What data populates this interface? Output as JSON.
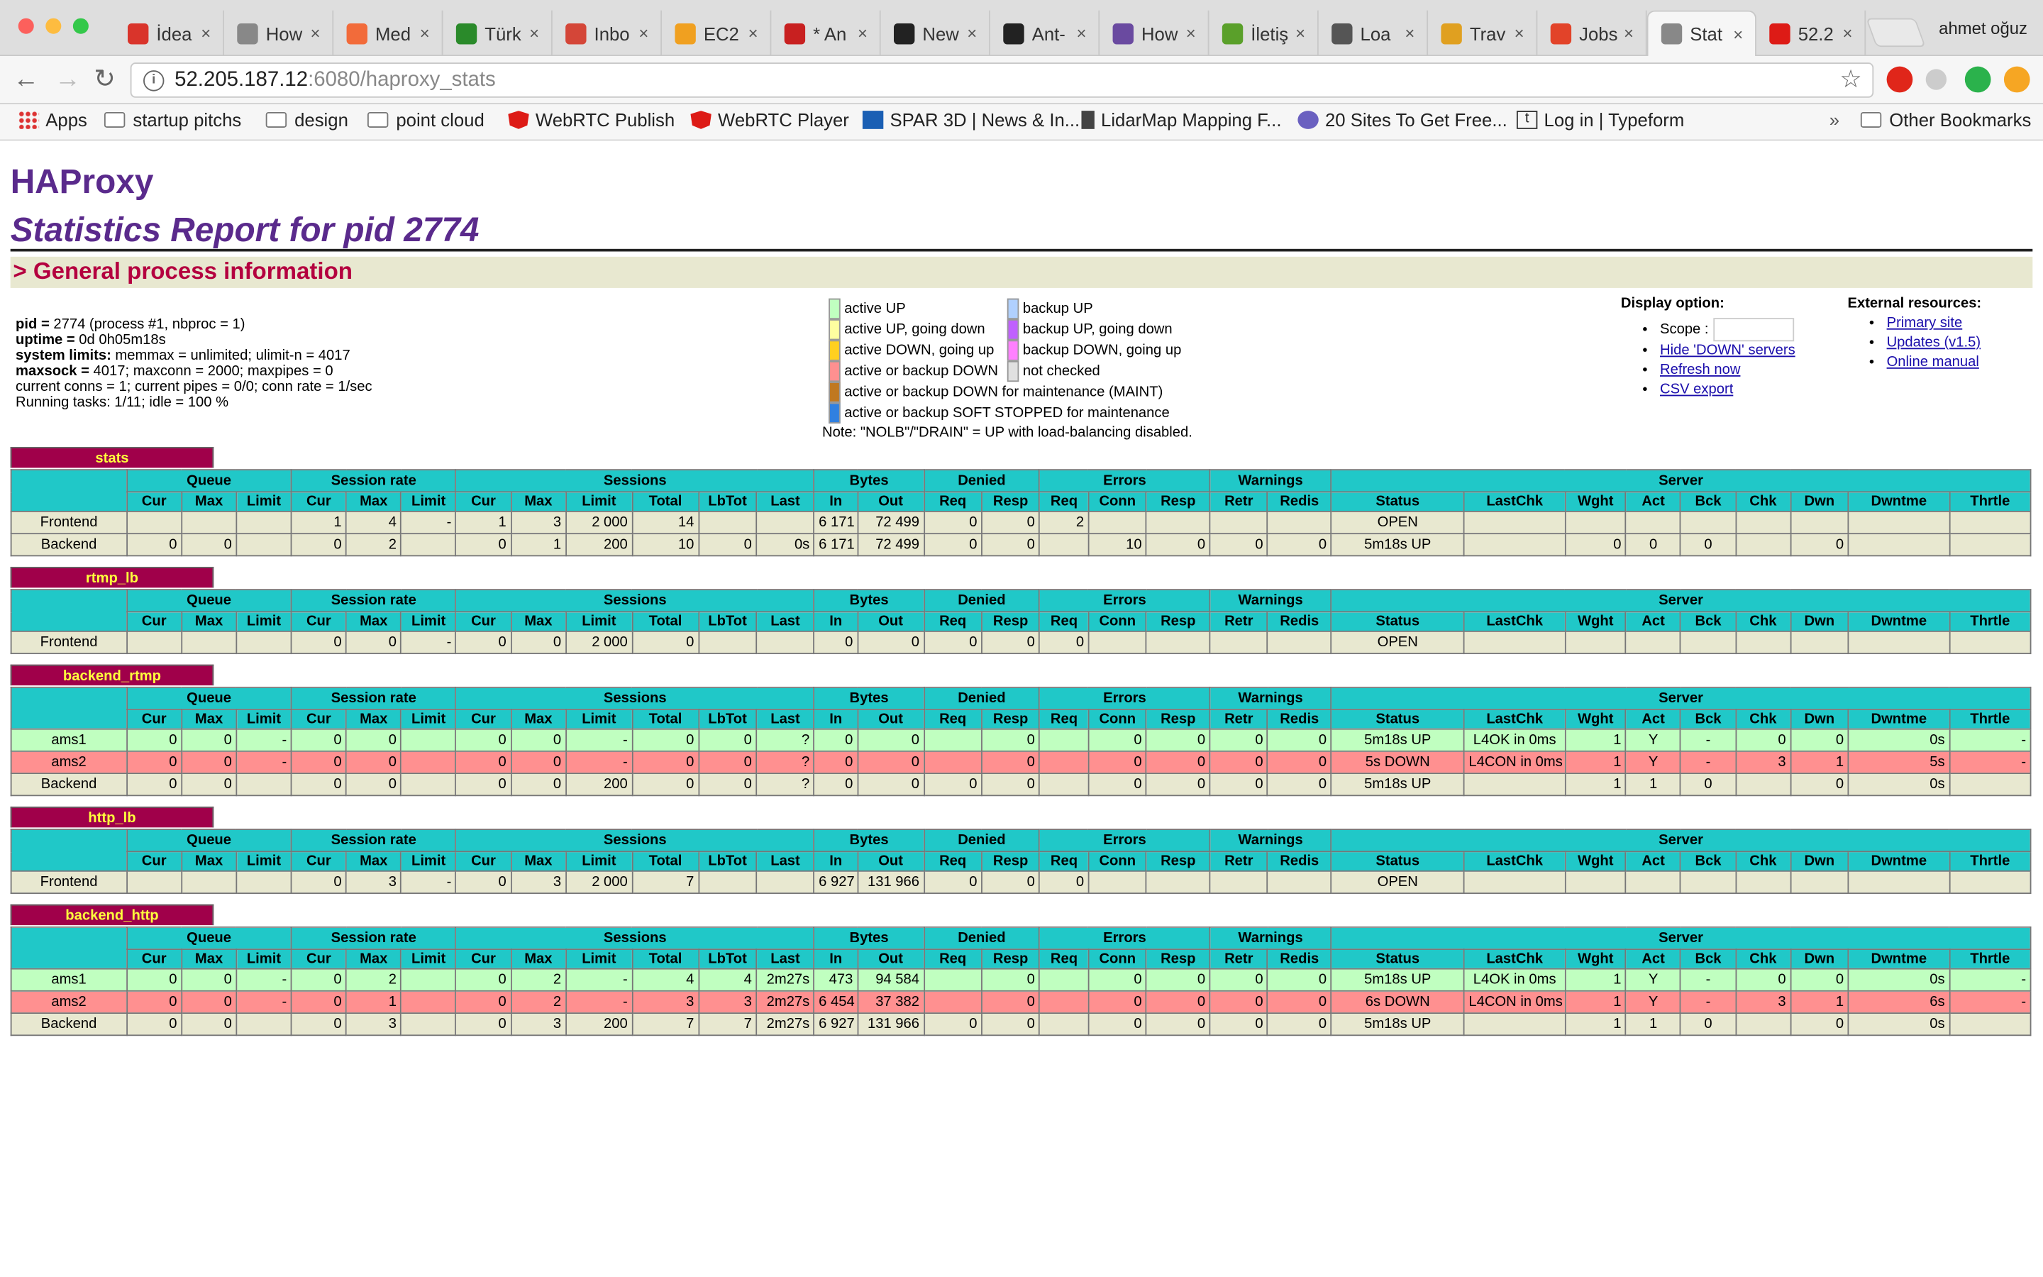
{
  "browser": {
    "profile": "ahmet oğuz",
    "tabs": [
      {
        "label": "İdea",
        "icon": "exclamation-icon",
        "color": "#d9342b"
      },
      {
        "label": "How",
        "icon": "document-icon",
        "color": "#888888"
      },
      {
        "label": "Med",
        "icon": "play-icon",
        "color": "#f26b3a"
      },
      {
        "label": "Türk",
        "icon": "grid-icon",
        "color": "#2a8a2a"
      },
      {
        "label": "Inbo",
        "icon": "gmail-icon",
        "color": "#d44638"
      },
      {
        "label": "EC2",
        "icon": "box-icon",
        "color": "#f0a020"
      },
      {
        "label": "* An",
        "icon": "quote-icon",
        "color": "#c82020"
      },
      {
        "label": "New",
        "icon": "github-icon",
        "color": "#222222"
      },
      {
        "label": "Ant-",
        "icon": "github-icon",
        "color": "#222222"
      },
      {
        "label": "How",
        "icon": "shield-icon",
        "color": "#6a4aa0"
      },
      {
        "label": "İletiş",
        "icon": "leaf-icon",
        "color": "#5aa02a"
      },
      {
        "label": "Loa",
        "icon": "play-circle-icon",
        "color": "#555555"
      },
      {
        "label": "Trav",
        "icon": "face-icon",
        "color": "#e0a020"
      },
      {
        "label": "Jobs",
        "icon": "gitlab-icon",
        "color": "#e24329"
      },
      {
        "label": "Stat",
        "icon": "document-icon",
        "color": "#888888"
      },
      {
        "label": "52.2",
        "icon": "angular-icon",
        "color": "#dd1b16"
      }
    ],
    "active_tab": 14,
    "url_host": "52.205.187.12",
    "url_path": ":6080/haproxy_stats",
    "bookmarks": [
      {
        "label": "Apps",
        "kind": "apps"
      },
      {
        "label": "startup pitchs",
        "kind": "folder"
      },
      {
        "label": "design",
        "kind": "folder"
      },
      {
        "label": "point cloud",
        "kind": "folder"
      },
      {
        "label": "WebRTC Publish",
        "kind": "angular"
      },
      {
        "label": "WebRTC Player",
        "kind": "angular"
      },
      {
        "label": "SPAR 3D | News & In...",
        "kind": "chart"
      },
      {
        "label": "LidarMap Mapping F...",
        "kind": "person"
      },
      {
        "label": "20 Sites To Get Free...",
        "kind": "globe"
      },
      {
        "label": "Log in | Typeform",
        "kind": "t"
      }
    ],
    "bookmarks_more": "»",
    "other_bookmarks": "Other Bookmarks"
  },
  "page": {
    "title": "HAProxy",
    "subtitle": "Statistics Report for pid 2774",
    "section": "> General process information",
    "process_info": [
      {
        "k": "pid = ",
        "v": "2774 (process #1, nbproc = 1)"
      },
      {
        "k": "uptime = ",
        "v": "0d 0h05m18s"
      },
      {
        "k": "system limits:",
        "v": " memmax = unlimited; ulimit-n = 4017"
      },
      {
        "k": "maxsock = ",
        "v": "4017; maxconn = 2000; maxpipes = 0"
      },
      {
        "k": "",
        "v": "current conns = 1; current pipes = 0/0; conn rate = 1/sec"
      },
      {
        "k": "",
        "v": "Running tasks: 1/11; idle = 100 %"
      }
    ],
    "legend": [
      {
        "label": "active UP",
        "color": "#c0ffc0"
      },
      {
        "label": "backup UP",
        "color": "#b0d0ff"
      },
      {
        "label": "active UP, going down",
        "color": "#ffffa0"
      },
      {
        "label": "backup UP, going down",
        "color": "#c060ff"
      },
      {
        "label": "active DOWN, going up",
        "color": "#ffd020"
      },
      {
        "label": "backup DOWN, going up",
        "color": "#ff80ff"
      },
      {
        "label": "active or backup DOWN",
        "color": "#ff9090"
      },
      {
        "label": "not checked",
        "color": "#e0e0e0"
      },
      {
        "label": "active or backup DOWN for maintenance (MAINT)",
        "color": "#c07820"
      },
      {
        "label": "active or backup SOFT STOPPED for maintenance",
        "color": "#3080e0"
      }
    ],
    "legend_note": "Note: \"NOLB\"/\"DRAIN\" = UP with load-balancing disabled.",
    "display_option": {
      "title": "Display option:",
      "scope": "Scope :",
      "links": [
        "Hide 'DOWN' servers",
        "Refresh now",
        "CSV export"
      ]
    },
    "external": {
      "title": "External resources:",
      "links": [
        "Primary site",
        "Updates (v1.5)",
        "Online manual"
      ]
    }
  },
  "groups": [
    "Queue",
    "Session rate",
    "Sessions",
    "Bytes",
    "Denied",
    "Errors",
    "Warnings",
    "Server"
  ],
  "columns": [
    "Cur",
    "Max",
    "Limit",
    "Cur",
    "Max",
    "Limit",
    "Cur",
    "Max",
    "Limit",
    "Total",
    "LbTot",
    "Last",
    "In",
    "Out",
    "Req",
    "Resp",
    "Req",
    "Conn",
    "Resp",
    "Retr",
    "Redis",
    "Status",
    "LastChk",
    "Wght",
    "Act",
    "Bck",
    "Chk",
    "Dwn",
    "Dwntme",
    "Thrtle"
  ],
  "proxies": [
    {
      "name": "stats",
      "rows": [
        {
          "type": "fe",
          "cells": [
            "Frontend",
            "",
            "",
            "",
            "1",
            "4",
            "-",
            "1",
            "3",
            "2 000",
            "14",
            "",
            "",
            "6 171",
            "72 499",
            "0",
            "0",
            "2",
            "",
            "",
            "",
            "",
            "OPEN",
            "",
            "",
            "",
            "",
            "",
            "",
            "",
            ""
          ]
        },
        {
          "type": "be",
          "cells": [
            "Backend",
            "0",
            "0",
            "",
            "0",
            "2",
            "",
            "0",
            "1",
            "200",
            "10",
            "0",
            "0s",
            "6 171",
            "72 499",
            "0",
            "0",
            "",
            "10",
            "0",
            "0",
            "0",
            "5m18s UP",
            "",
            "0",
            "0",
            "0",
            "",
            "0",
            "",
            ""
          ]
        }
      ]
    },
    {
      "name": "rtmp_lb",
      "rows": [
        {
          "type": "fe",
          "cells": [
            "Frontend",
            "",
            "",
            "",
            "0",
            "0",
            "-",
            "0",
            "0",
            "2 000",
            "0",
            "",
            "",
            "0",
            "0",
            "0",
            "0",
            "0",
            "",
            "",
            "",
            "",
            "OPEN",
            "",
            "",
            "",
            "",
            "",
            "",
            "",
            ""
          ]
        }
      ]
    },
    {
      "name": "backend_rtmp",
      "rows": [
        {
          "type": "up",
          "cells": [
            "ams1",
            "0",
            "0",
            "-",
            "0",
            "0",
            "",
            "0",
            "0",
            "-",
            "0",
            "0",
            "?",
            "0",
            "0",
            "",
            "0",
            "",
            "0",
            "0",
            "0",
            "0",
            "5m18s UP",
            "L4OK in 0ms",
            "1",
            "Y",
            "-",
            "0",
            "0",
            "0s",
            "-"
          ]
        },
        {
          "type": "dn",
          "cells": [
            "ams2",
            "0",
            "0",
            "-",
            "0",
            "0",
            "",
            "0",
            "0",
            "-",
            "0",
            "0",
            "?",
            "0",
            "0",
            "",
            "0",
            "",
            "0",
            "0",
            "0",
            "0",
            "5s DOWN",
            "L4CON in 0ms",
            "1",
            "Y",
            "-",
            "3",
            "1",
            "5s",
            "-"
          ]
        },
        {
          "type": "be",
          "cells": [
            "Backend",
            "0",
            "0",
            "",
            "0",
            "0",
            "",
            "0",
            "0",
            "200",
            "0",
            "0",
            "?",
            "0",
            "0",
            "0",
            "0",
            "",
            "0",
            "0",
            "0",
            "0",
            "5m18s UP",
            "",
            "1",
            "1",
            "0",
            "",
            "0",
            "0s",
            ""
          ]
        }
      ]
    },
    {
      "name": "http_lb",
      "rows": [
        {
          "type": "fe",
          "cells": [
            "Frontend",
            "",
            "",
            "",
            "0",
            "3",
            "-",
            "0",
            "3",
            "2 000",
            "7",
            "",
            "",
            "6 927",
            "131 966",
            "0",
            "0",
            "0",
            "",
            "",
            "",
            "",
            "OPEN",
            "",
            "",
            "",
            "",
            "",
            "",
            "",
            ""
          ]
        }
      ]
    },
    {
      "name": "backend_http",
      "rows": [
        {
          "type": "up",
          "cells": [
            "ams1",
            "0",
            "0",
            "-",
            "0",
            "2",
            "",
            "0",
            "2",
            "-",
            "4",
            "4",
            "2m27s",
            "473",
            "94 584",
            "",
            "0",
            "",
            "0",
            "0",
            "0",
            "0",
            "5m18s UP",
            "L4OK in 0ms",
            "1",
            "Y",
            "-",
            "0",
            "0",
            "0s",
            "-"
          ]
        },
        {
          "type": "dn",
          "cells": [
            "ams2",
            "0",
            "0",
            "-",
            "0",
            "1",
            "",
            "0",
            "2",
            "-",
            "3",
            "3",
            "2m27s",
            "6 454",
            "37 382",
            "",
            "0",
            "",
            "0",
            "0",
            "0",
            "0",
            "6s DOWN",
            "L4CON in 0ms",
            "1",
            "Y",
            "-",
            "3",
            "1",
            "6s",
            "-"
          ]
        },
        {
          "type": "be",
          "cells": [
            "Backend",
            "0",
            "0",
            "",
            "0",
            "3",
            "",
            "0",
            "3",
            "200",
            "7",
            "7",
            "2m27s",
            "6 927",
            "131 966",
            "0",
            "0",
            "",
            "0",
            "0",
            "0",
            "0",
            "5m18s UP",
            "",
            "1",
            "1",
            "0",
            "",
            "0",
            "0s",
            ""
          ]
        }
      ]
    }
  ]
}
